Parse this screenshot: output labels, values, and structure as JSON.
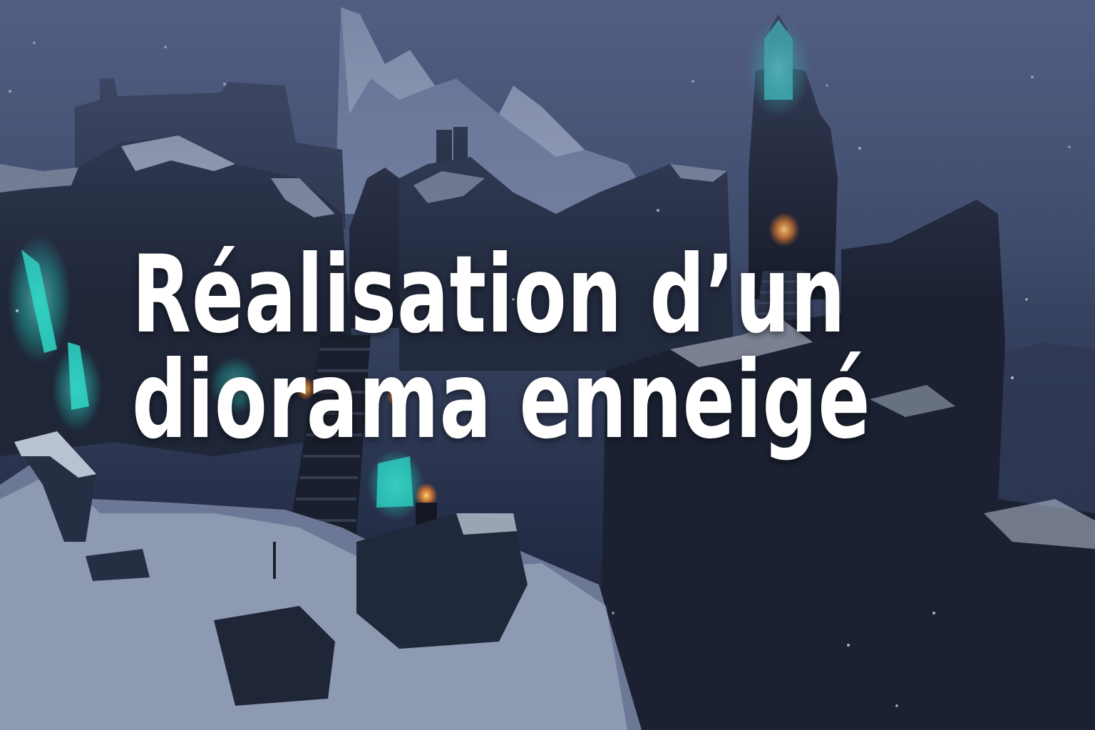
{
  "title": {
    "line1": "Réalisation d’un",
    "line2": "diorama enneigé"
  },
  "colors": {
    "sky": "#3c4867",
    "rock": "#1f2638",
    "snow": "#c8d2e4",
    "crystal": "#2fd8c8",
    "torch": "#ff9a3a",
    "text": "#ffffff"
  }
}
